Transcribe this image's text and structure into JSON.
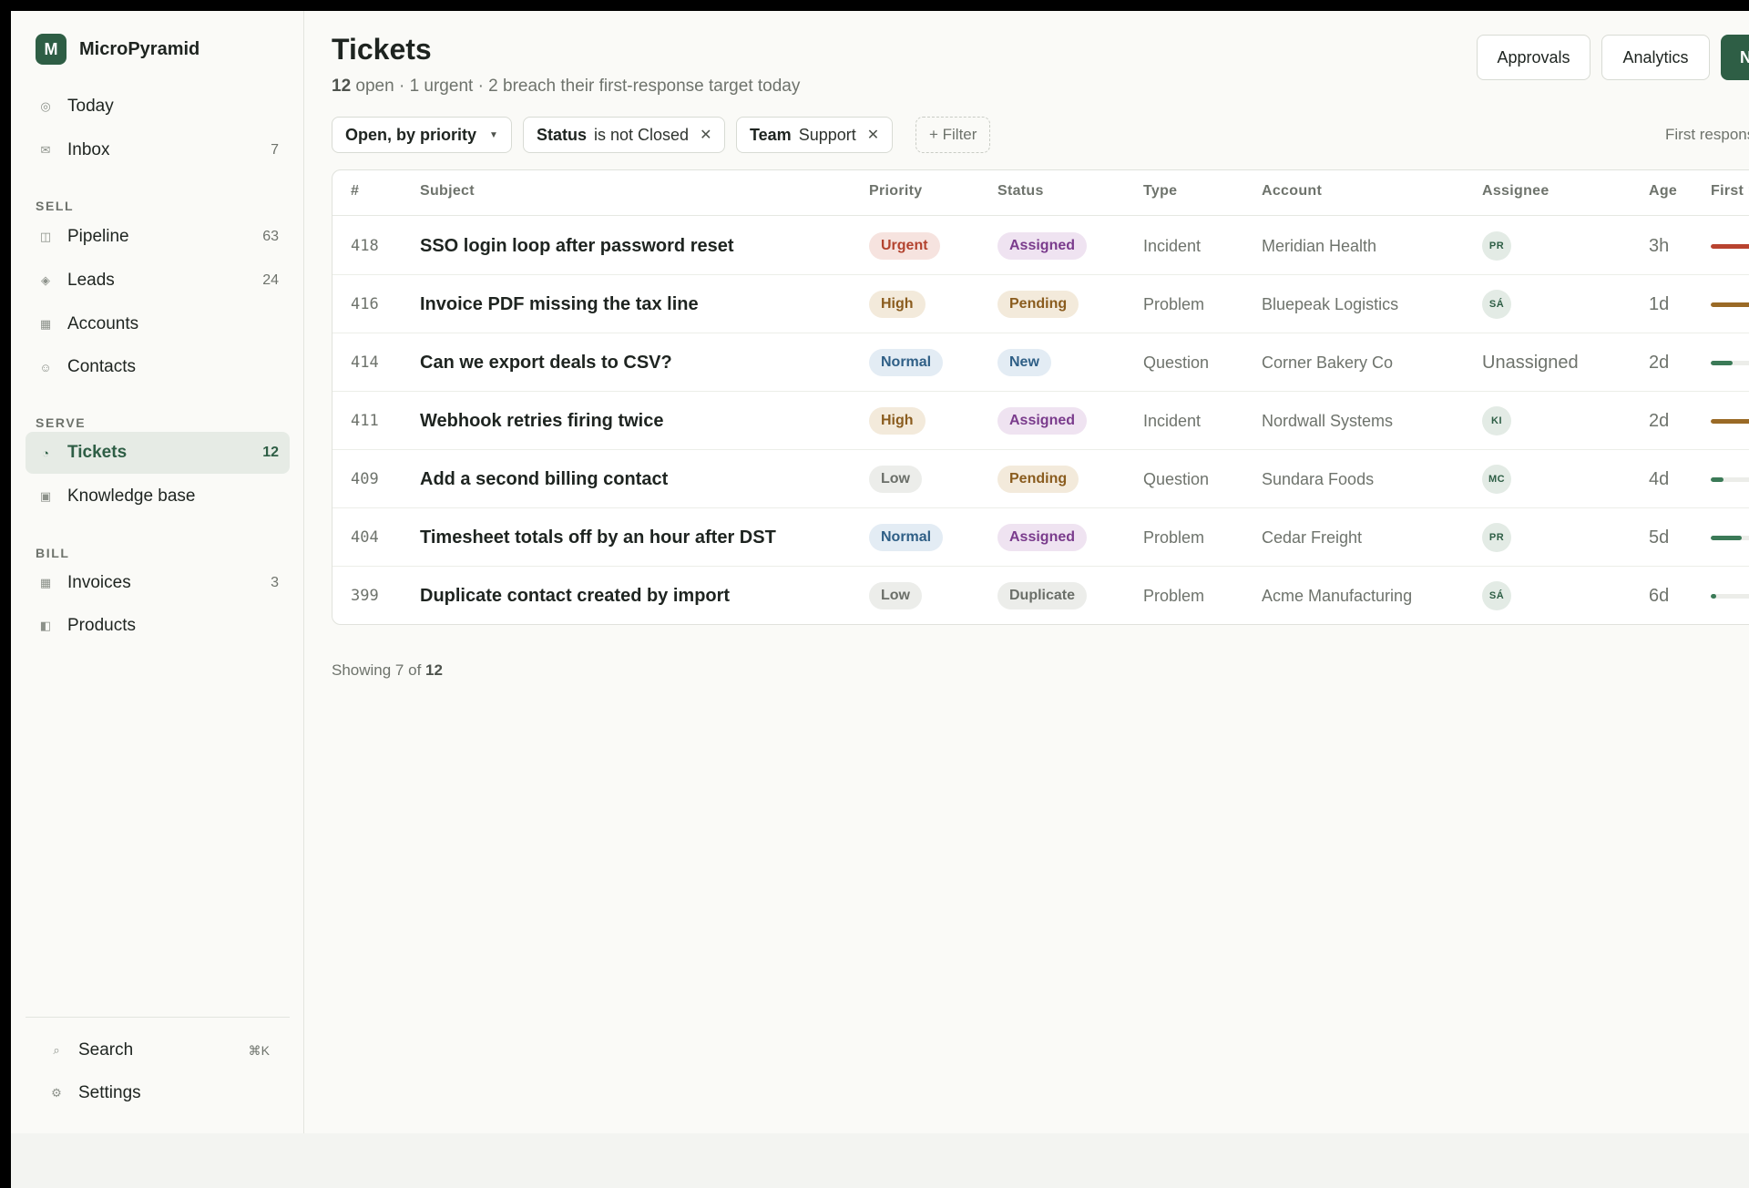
{
  "brand": {
    "logo_letter": "M",
    "name": "MicroPyramid"
  },
  "nav": {
    "top": [
      {
        "icon": "circle-icon",
        "glyph": "◎",
        "label": "Today",
        "count": ""
      },
      {
        "icon": "mail-icon",
        "glyph": "✉",
        "label": "Inbox",
        "count": "7"
      }
    ],
    "sections": [
      {
        "label": "SELL",
        "items": [
          {
            "icon": "pipeline-icon",
            "glyph": "◫",
            "label": "Pipeline",
            "count": "63"
          },
          {
            "icon": "diamond-icon",
            "glyph": "◈",
            "label": "Leads",
            "count": "24"
          },
          {
            "icon": "square-icon",
            "glyph": "▦",
            "label": "Accounts",
            "count": ""
          },
          {
            "icon": "person-icon",
            "glyph": "☺",
            "label": "Contacts",
            "count": ""
          }
        ]
      },
      {
        "label": "SERVE",
        "items": [
          {
            "icon": "ticket-icon",
            "glyph": "◔",
            "label": "Tickets",
            "count": "12",
            "active": true
          },
          {
            "icon": "book-icon",
            "glyph": "▣",
            "label": "Knowledge base",
            "count": ""
          }
        ]
      },
      {
        "label": "BILL",
        "items": [
          {
            "icon": "invoice-icon",
            "glyph": "▦",
            "label": "Invoices",
            "count": "3"
          },
          {
            "icon": "product-icon",
            "glyph": "◧",
            "label": "Products",
            "count": ""
          }
        ]
      }
    ],
    "footer": [
      {
        "icon": "search-icon",
        "glyph": "⌕",
        "label": "Search",
        "shortcut": "⌘K"
      },
      {
        "icon": "gear-icon",
        "glyph": "⚙",
        "label": "Settings",
        "shortcut": ""
      }
    ]
  },
  "header": {
    "title": "Tickets",
    "subtitle_count": "12",
    "subtitle_rest": " open · 1 urgent · 2 breach their first-response target today",
    "buttons": {
      "approvals": "Approvals",
      "analytics": "Analytics",
      "new": "New ticket"
    }
  },
  "filters": {
    "view": "Open, by priority",
    "status": {
      "key": "Status",
      "value": "is not Closed"
    },
    "team": {
      "key": "Team",
      "value": "Support"
    },
    "add": "+ Filter",
    "right_note": "First response SLA"
  },
  "table": {
    "columns": [
      "#",
      "Subject",
      "Priority",
      "Status",
      "Type",
      "Account",
      "Assignee",
      "Age",
      "First response"
    ],
    "rows": [
      {
        "num": "418",
        "subject": "SSO login loop after password reset",
        "priority": "Urgent",
        "status": "Assigned",
        "type": "Incident",
        "account": "Meridian Health",
        "assignee": "PR",
        "age": "3h",
        "sla": 0.98,
        "sla_color": "#b8432f"
      },
      {
        "num": "416",
        "subject": "Invoice PDF missing the tax line",
        "priority": "High",
        "status": "Pending",
        "type": "Problem",
        "account": "Bluepeak Logistics",
        "assignee": "SÁ",
        "age": "1d",
        "sla": 0.85,
        "sla_color": "#9a6a26"
      },
      {
        "num": "414",
        "subject": "Can we export deals to CSV?",
        "priority": "Normal",
        "status": "New",
        "type": "Question",
        "account": "Corner Bakery Co",
        "assignee": "Unassigned",
        "age": "2d",
        "sla": 0.3,
        "sla_color": "#3b7a57"
      },
      {
        "num": "411",
        "subject": "Webhook retries firing twice",
        "priority": "High",
        "status": "Assigned",
        "type": "Incident",
        "account": "Nordwall Systems",
        "assignee": "KI",
        "age": "2d",
        "sla": 0.9,
        "sla_color": "#9a6a26"
      },
      {
        "num": "409",
        "subject": "Add a second billing contact",
        "priority": "Low",
        "status": "Pending",
        "type": "Question",
        "account": "Sundara Foods",
        "assignee": "MC",
        "age": "4d",
        "sla": 0.18,
        "sla_color": "#3b7a57"
      },
      {
        "num": "404",
        "subject": "Timesheet totals off by an hour after DST",
        "priority": "Normal",
        "status": "Assigned",
        "type": "Problem",
        "account": "Cedar Freight",
        "assignee": "PR",
        "age": "5d",
        "sla": 0.42,
        "sla_color": "#3b7a57"
      },
      {
        "num": "399",
        "subject": "Duplicate contact created by import",
        "priority": "Low",
        "status": "Duplicate",
        "type": "Problem",
        "account": "Acme Manufacturing",
        "assignee": "SÁ",
        "age": "6d",
        "sla": 0.08,
        "sla_color": "#3b7a57"
      }
    ]
  },
  "footer_info": {
    "prefix": "Showing 7 of ",
    "total": "12"
  },
  "colors": {
    "accent": "#2e5e45",
    "priority": {
      "Urgent": {
        "bg": "#f6e3df",
        "fg": "#b3432f"
      },
      "High": {
        "bg": "#f3eadb",
        "fg": "#8a5c1e"
      },
      "Normal": {
        "bg": "#e3ecf4",
        "fg": "#2f5f86"
      },
      "Low": {
        "bg": "#ecedea",
        "fg": "#6b6f69"
      }
    },
    "status": {
      "Assigned": {
        "bg": "#efe3f1",
        "fg": "#7a3b8c"
      },
      "Pending": {
        "bg": "#f3eadb",
        "fg": "#8a5c1e"
      },
      "New": {
        "bg": "#e3ecf4",
        "fg": "#2f5f86"
      },
      "Duplicate": {
        "bg": "#ecedea",
        "fg": "#6b6f69"
      }
    }
  }
}
